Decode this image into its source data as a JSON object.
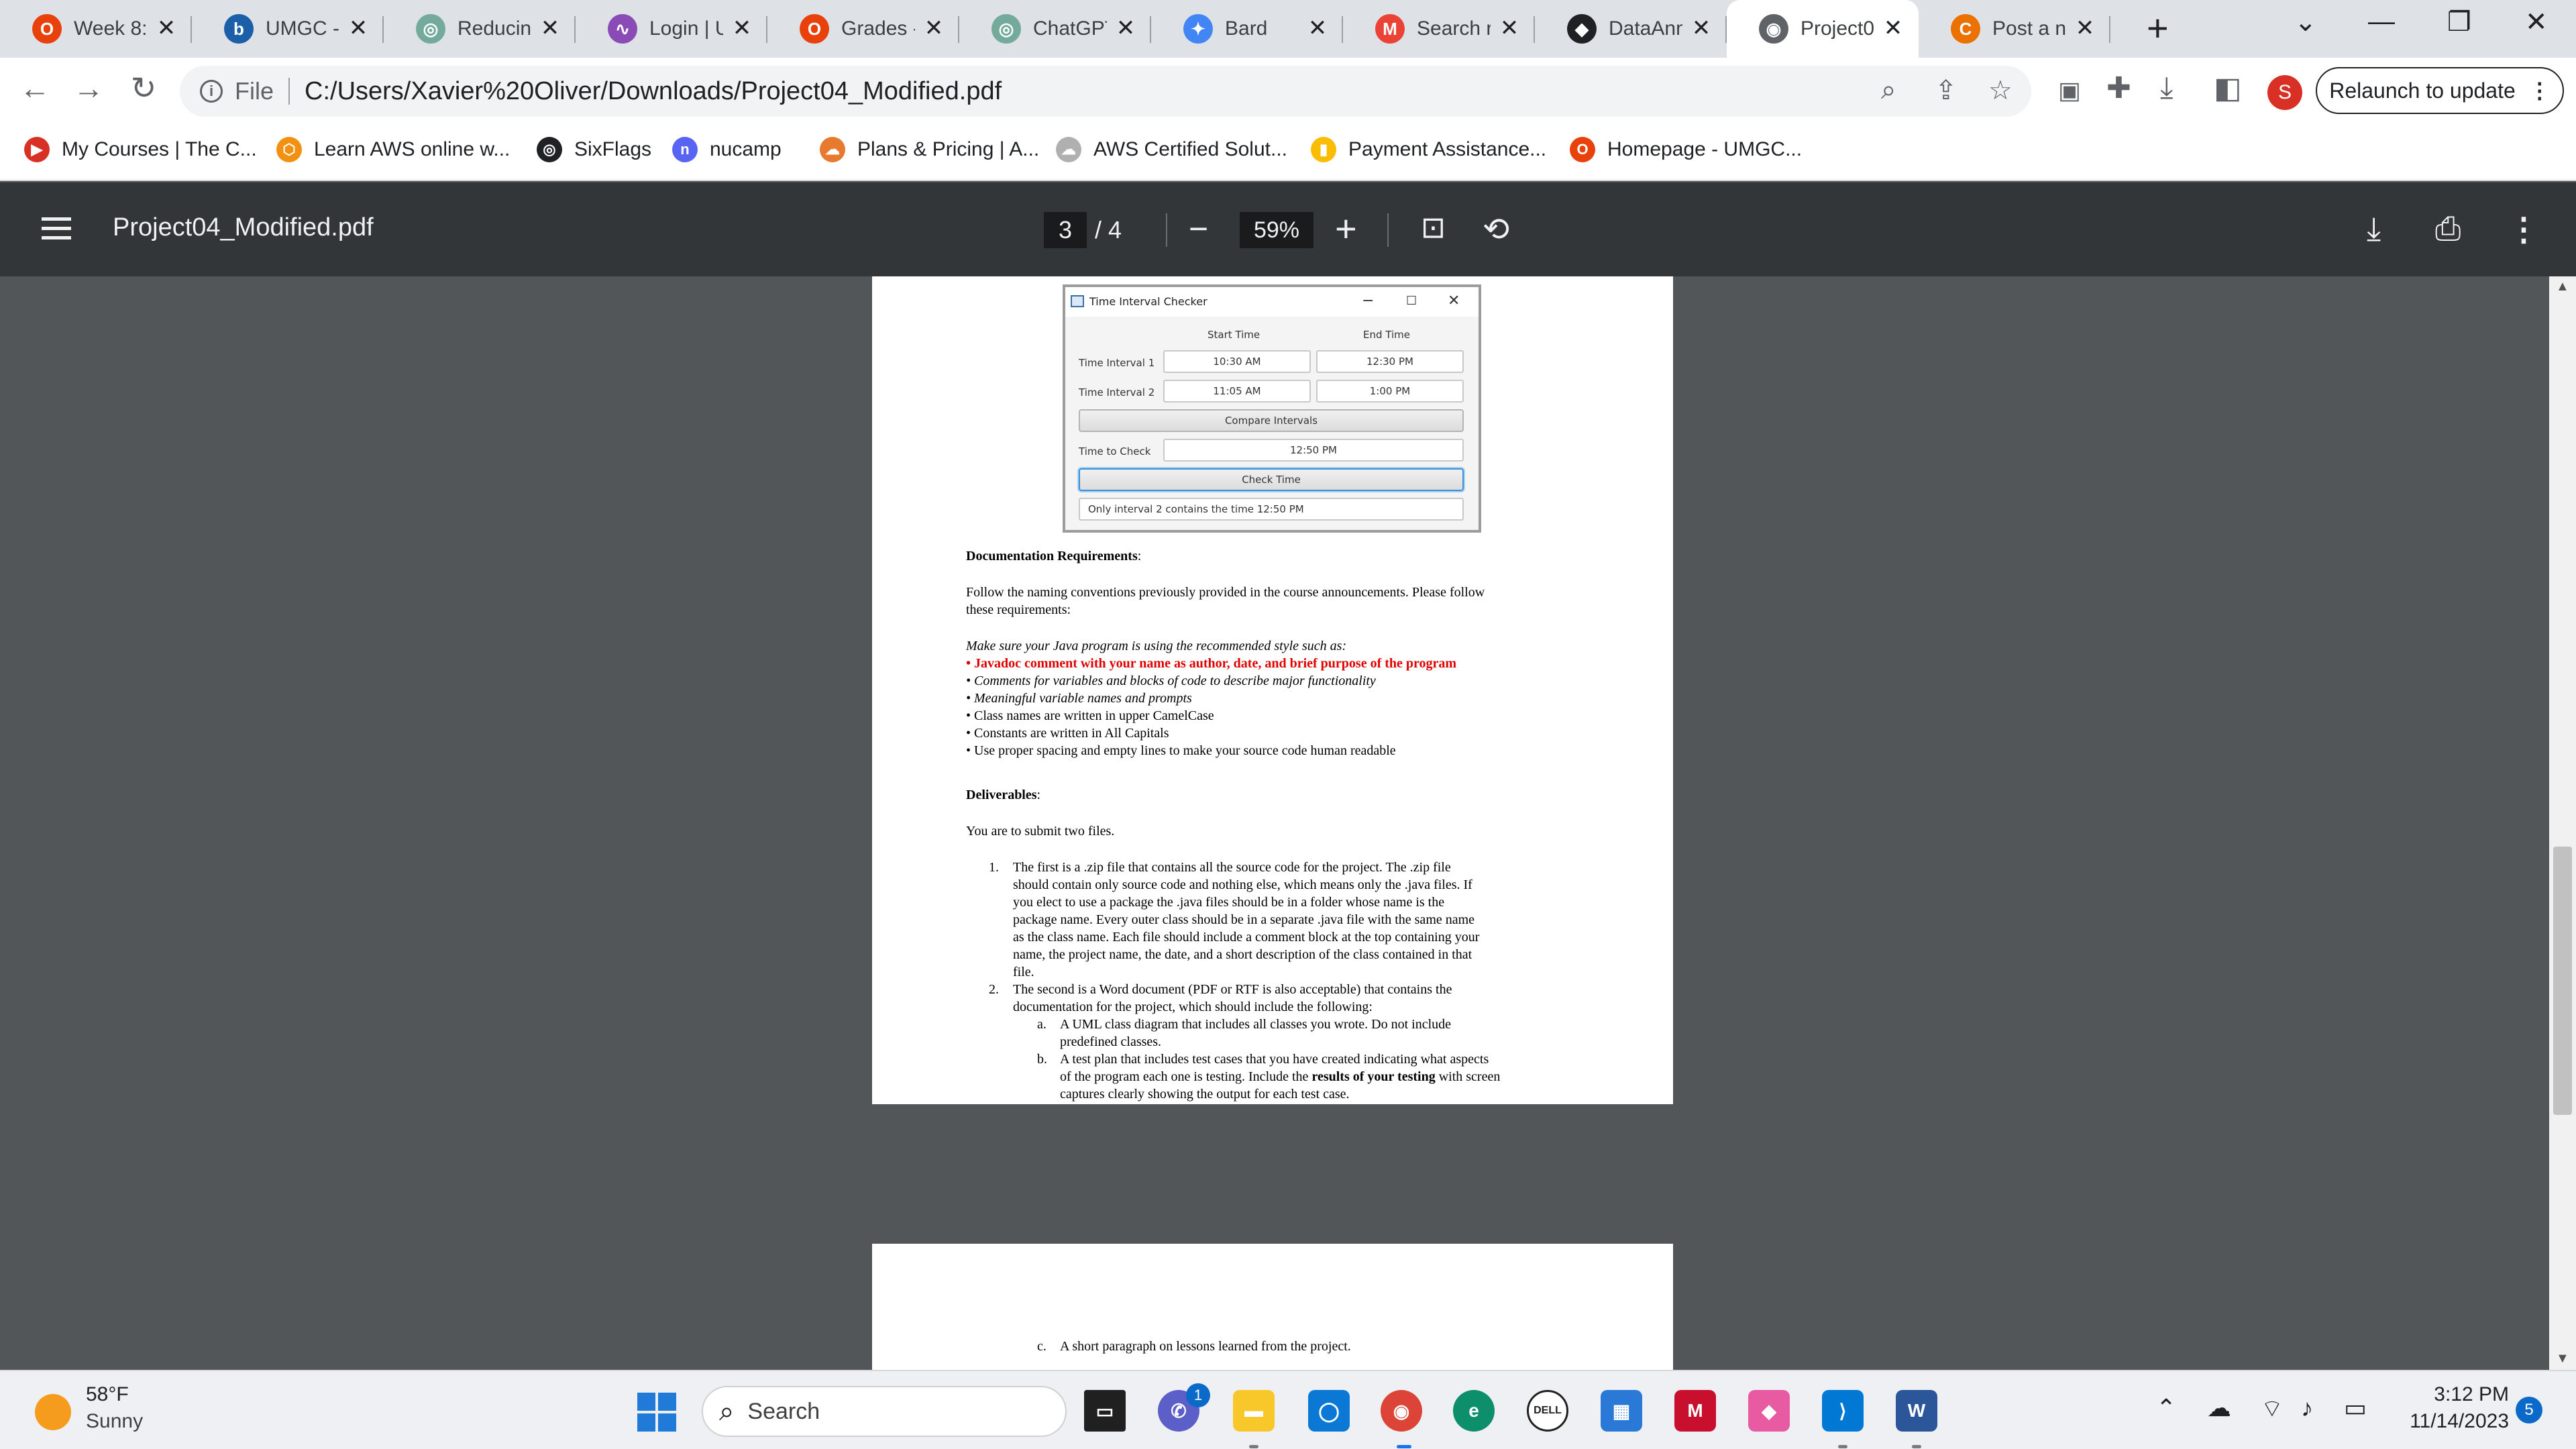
{
  "browser": {
    "tabs": [
      {
        "title": "Week 8:",
        "icon": "wgu-icon",
        "color": "#e8410b",
        "glyph": "O"
      },
      {
        "title": "UMGC -",
        "icon": "blackboard-icon",
        "color": "#1a5fa8",
        "glyph": "b"
      },
      {
        "title": "Reducing",
        "icon": "chatgpt-icon",
        "color": "#74aa9c",
        "glyph": "◎"
      },
      {
        "title": "Login | U",
        "icon": "login-icon",
        "color": "#8a4bb6",
        "glyph": "∿"
      },
      {
        "title": "Grades -",
        "icon": "wgu-icon",
        "color": "#e8410b",
        "glyph": "O"
      },
      {
        "title": "ChatGPT",
        "icon": "chatgpt-icon",
        "color": "#74aa9c",
        "glyph": "◎"
      },
      {
        "title": "Bard",
        "icon": "bard-icon",
        "color": "#4285f4",
        "glyph": "✦"
      },
      {
        "title": "Search re",
        "icon": "gmail-icon",
        "color": "#ea4335",
        "glyph": "M"
      },
      {
        "title": "DataAnn",
        "icon": "dataann-icon",
        "color": "#202124",
        "glyph": "◆"
      },
      {
        "title": "Project0",
        "icon": "globe-icon",
        "color": "#5f6368",
        "glyph": "◉",
        "active": true
      },
      {
        "title": "Post a ne",
        "icon": "chegg-icon",
        "color": "#eb7100",
        "glyph": "C"
      }
    ],
    "address": {
      "scheme": "File",
      "url": "C:/Users/Xavier%20Oliver/Downloads/Project04_Modified.pdf"
    },
    "relaunch_label": "Relaunch to update",
    "profile_initial": "S",
    "bookmarks": [
      {
        "label": "My Courses | The C...",
        "color": "#d93025",
        "glyph": "▶"
      },
      {
        "label": "Learn AWS online w...",
        "color": "#f29111",
        "glyph": "⬡"
      },
      {
        "label": "SixFlags",
        "color": "#202124",
        "glyph": "◎"
      },
      {
        "label": "nucamp",
        "color": "#5865f2",
        "glyph": "n"
      },
      {
        "label": "Plans & Pricing | A...",
        "color": "#e87a2f",
        "glyph": "☁"
      },
      {
        "label": "AWS Certified Solut...",
        "color": "#b0b0b0",
        "glyph": "☁"
      },
      {
        "label": "Payment Assistance...",
        "color": "#fbbc04",
        "glyph": "▮"
      },
      {
        "label": "Homepage - UMGC...",
        "color": "#e8410b",
        "glyph": "O"
      }
    ]
  },
  "pdf": {
    "title": "Project04_Modified.pdf",
    "current_page": "3",
    "total_pages": "/ 4",
    "zoom": "59%"
  },
  "fxapp": {
    "window_title": "Time Interval Checker",
    "header_start": "Start Time",
    "header_end": "End Time",
    "interval1_label": "Time Interval 1",
    "interval1_start": "10:30 AM",
    "interval1_end": "12:30 PM",
    "interval2_label": "Time Interval 2",
    "interval2_start": "11:05 AM",
    "interval2_end": "1:00 PM",
    "compare_button": "Compare Intervals",
    "check_label": "Time to Check",
    "check_value": "12:50 PM",
    "check_button": "Check Time",
    "result": "Only interval 2 contains the time 12:50 PM"
  },
  "doc": {
    "doc_req_heading": "Documentation Requirements",
    "doc_req_colon": ":",
    "naming_line1": "Follow the naming conventions previously provided in the course announcements. Please follow",
    "naming_line2": "these requirements:",
    "style_intro": "Make sure your Java program is using the recommended style such as:",
    "bullets": [
      "• Javadoc comment with your name as author, date, and brief purpose of the program",
      "• Comments for variables and blocks of code to describe major functionality",
      "• Meaningful variable names and prompts",
      "• Class names are written in upper CamelCase",
      "• Constants are written in All Capitals",
      "• Use proper spacing and empty lines to make your source code human readable"
    ],
    "deliverables_heading": "Deliverables",
    "deliverables_colon": ":",
    "submit_line": "You are to submit two files.",
    "item1_num": "1.",
    "item1_lines": [
      "The first is a .zip file that contains all the source code for the project. The .zip file",
      "should contain only source code and nothing else, which means only the .java files. If",
      "you elect to use a package the .java files should be in a folder whose name is the",
      "package name. Every outer class should be in a separate .java file with the same name",
      "as the class name. Each file should include a comment block at the top containing your",
      "name, the project name, the date, and a short description of the class contained in that",
      "file."
    ],
    "item2_num": "2.",
    "item2_lines": [
      "The second is a Word document (PDF or RTF is also acceptable) that contains the",
      "documentation for the project, which should include the following:"
    ],
    "sub_a_num": "a.",
    "sub_a_lines": [
      "A UML class diagram that includes all classes you wrote. Do not include",
      "predefined classes."
    ],
    "sub_b_num": "b.",
    "sub_b_line1_pre": "A test plan that includes test cases that you have created indicating what aspects",
    "sub_b_line2_pre": "of the program each one is testing. Include the ",
    "sub_b_line2_bold": "results of your testing",
    "sub_b_line2_post": " with screen",
    "sub_b_line3": "captures clearly showing the output for each test case.",
    "sub_c_num": "c.",
    "sub_c": "A short paragraph on lessons learned from the project."
  },
  "taskbar": {
    "temp": "58°F",
    "condition": "Sunny",
    "search": "Search",
    "time": "3:12 PM",
    "date": "11/14/2023",
    "notifications": "5",
    "chat_badge": "1"
  }
}
